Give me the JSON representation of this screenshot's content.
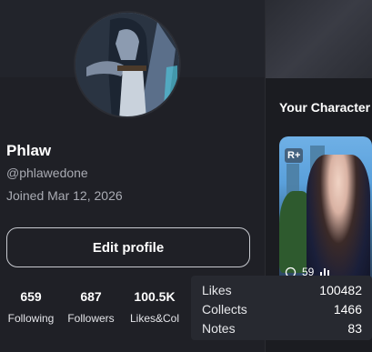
{
  "profile": {
    "name": "Phlaw",
    "handle": "@phlawedone",
    "joined": "Joined Mar 12, 2026",
    "edit_label": "Edit profile",
    "stats": [
      {
        "value": "659",
        "label": "Following"
      },
      {
        "value": "687",
        "label": "Followers"
      },
      {
        "value": "100.5K",
        "label": "Likes&Col"
      }
    ]
  },
  "characters": {
    "title": "Your Character",
    "card": {
      "badge": "R+",
      "count": "59"
    }
  },
  "tooltip": {
    "rows": [
      {
        "key": "Likes",
        "value": "100482"
      },
      {
        "key": "Collects",
        "value": "1466"
      },
      {
        "key": "Notes",
        "value": "83"
      }
    ]
  }
}
